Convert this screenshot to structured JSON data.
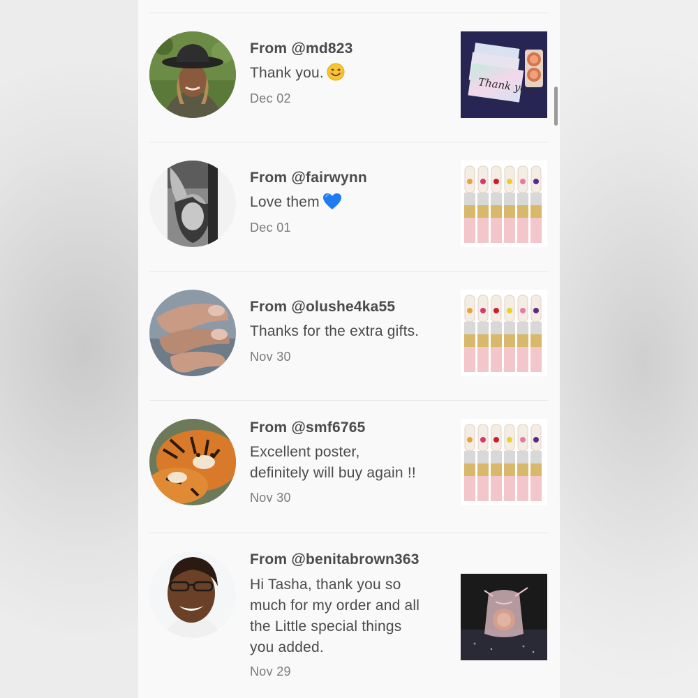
{
  "messages": [
    {
      "from": "From @md823",
      "text": "Thank you.",
      "emoji": "smiling-face-emoji",
      "date": "Dec 02",
      "thumbnail": "thank-you-cards-photo"
    },
    {
      "from": "From @fairwynn",
      "text": "Love them",
      "emoji": "blue-heart-emoji",
      "date": "Dec 01",
      "thumbnail": "flower-lipstick-set-photo"
    },
    {
      "from": "From @olushe4ka55",
      "text": "Thanks for the extra gifts.",
      "date": "Nov 30",
      "thumbnail": "flower-lipstick-set-photo"
    },
    {
      "from": "From @smf6765",
      "text_lines": [
        "Excellent poster,",
        "definitely will buy again !!"
      ],
      "date": "Nov 30",
      "thumbnail": "flower-lipstick-set-photo"
    },
    {
      "from": "From @benitabrown363",
      "text_lines": [
        "Hi Tasha, thank you so",
        "much for my order and all",
        "the Little special things",
        "you added."
      ],
      "date": "Nov 29",
      "thumbnail": "organza-gift-bag-photo"
    }
  ],
  "colors": {
    "text": "#4a4a4a",
    "date": "#7a7a7a",
    "background": "#f9f9f9",
    "divider": "#e6e6e6",
    "heart": "#1e7cf0",
    "smile": "#f7c531"
  }
}
